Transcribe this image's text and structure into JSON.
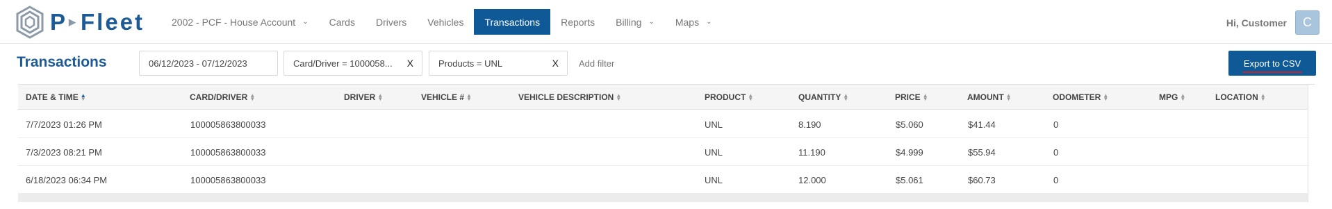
{
  "brand": {
    "name": "Fleet",
    "prefix": "P"
  },
  "nav": {
    "account": "2002 - PCF - House Account",
    "cards": "Cards",
    "drivers": "Drivers",
    "vehicles": "Vehicles",
    "transactions": "Transactions",
    "reports": "Reports",
    "billing": "Billing",
    "maps": "Maps"
  },
  "user": {
    "greeting": "Hi, Customer",
    "initial": "C"
  },
  "page": {
    "title": "Transactions"
  },
  "filters": {
    "date_range": "06/12/2023 - 07/12/2023",
    "card_driver": "Card/Driver = 1000058...",
    "products": "Products = UNL",
    "remove_label": "X",
    "add_filter": "Add filter"
  },
  "actions": {
    "export": "Export to CSV"
  },
  "table": {
    "columns": [
      "DATE & TIME",
      "CARD/DRIVER",
      "DRIVER",
      "VEHICLE #",
      "VEHICLE DESCRIPTION",
      "PRODUCT",
      "QUANTITY",
      "PRICE",
      "AMOUNT",
      "ODOMETER",
      "MPG",
      "LOCATION"
    ],
    "rows": [
      [
        "7/7/2023 01:26 PM",
        "100005863800033",
        "",
        "",
        "",
        "UNL",
        "8.190",
        "$5.060",
        "$41.44",
        "0",
        "",
        ""
      ],
      [
        "7/3/2023 08:21 PM",
        "100005863800033",
        "",
        "",
        "",
        "UNL",
        "11.190",
        "$4.999",
        "$55.94",
        "0",
        "",
        ""
      ],
      [
        "6/18/2023 06:34 PM",
        "100005863800033",
        "",
        "",
        "",
        "UNL",
        "12.000",
        "$5.061",
        "$60.73",
        "0",
        "",
        ""
      ]
    ]
  },
  "colors": {
    "primary": "#0f5a96",
    "brand_text": "#1d5a96",
    "accent_underline": "#c0272d"
  }
}
